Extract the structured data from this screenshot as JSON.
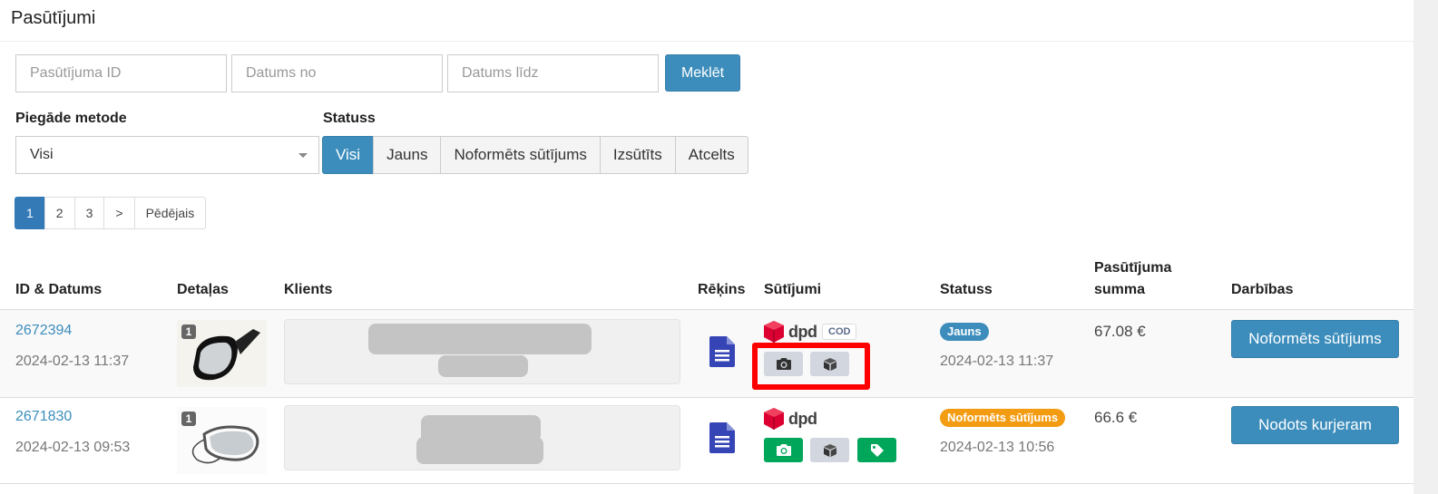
{
  "page": {
    "title": "Pasūtījumi"
  },
  "search": {
    "order_id_placeholder": "Pasūtījuma ID",
    "date_from_placeholder": "Datums no",
    "date_to_placeholder": "Datums līdz",
    "search_label": "Meklēt"
  },
  "filters": {
    "delivery_label": "Piegāde metode",
    "delivery_value": "Visi",
    "status_label": "Statuss",
    "status_options": [
      "Visi",
      "Jauns",
      "Noformēts sūtījums",
      "Izsūtīts",
      "Atcelts"
    ],
    "status_selected": "Visi"
  },
  "pagination": {
    "pages": [
      "1",
      "2",
      "3",
      ">",
      "Pēdējais"
    ],
    "current": "1"
  },
  "table": {
    "headers": {
      "id_date": "ID & Datums",
      "details": "Detaļas",
      "client": "Klients",
      "invoice": "Rēķins",
      "shipments": "Sūtījumi",
      "status": "Statuss",
      "amount_line1": "Pasūtījuma",
      "amount_line2": "summa",
      "actions": "Darbības"
    },
    "rows": [
      {
        "id": "2672394",
        "date": "2024-02-13 11:37",
        "item_count": "1",
        "carrier": "dpd",
        "cod": "COD",
        "status": "Jauns",
        "status_color": "#3c8dbc",
        "status_date": "2024-02-13 11:37",
        "amount": "67.08 €",
        "action": "Noformēts sūtījums"
      },
      {
        "id": "2671830",
        "date": "2024-02-13 09:53",
        "item_count": "1",
        "carrier": "dpd",
        "status": "Noformēts sūtījums",
        "status_color": "#f39c12",
        "status_date": "2024-02-13 10:56",
        "amount": "66.6 €",
        "action": "Nodots kurjeram"
      }
    ]
  },
  "colors": {
    "primary": "#3c8dbc",
    "success": "#00a65a",
    "warning": "#f39c12",
    "highlight": "#ff0000",
    "dpd_red": "#dc0032"
  }
}
